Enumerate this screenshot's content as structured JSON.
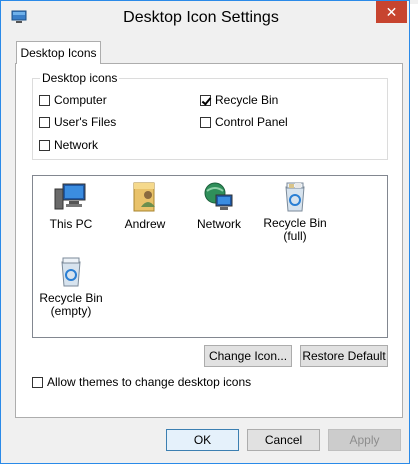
{
  "window": {
    "title": "Desktop Icon Settings",
    "close_symbol": "✕"
  },
  "tabs": [
    {
      "label": "Desktop Icons"
    }
  ],
  "desktop_icons_group": {
    "legend": "Desktop icons",
    "checkboxes": [
      {
        "label": "Computer",
        "checked": false
      },
      {
        "label": "User's Files",
        "checked": false
      },
      {
        "label": "Network",
        "checked": false
      },
      {
        "label": "Recycle Bin",
        "checked": true
      },
      {
        "label": "Control Panel",
        "checked": false
      }
    ]
  },
  "icon_list": {
    "items": [
      {
        "label": "This PC",
        "icon": "computer-icon"
      },
      {
        "label": "Andrew",
        "icon": "user-folder-icon"
      },
      {
        "label": "Network",
        "icon": "network-icon"
      },
      {
        "label": "Recycle Bin\n(full)",
        "icon": "recycle-bin-full-icon"
      },
      {
        "label": "Recycle Bin\n(empty)",
        "icon": "recycle-bin-empty-icon"
      }
    ]
  },
  "buttons": {
    "change_icon": "Change Icon...",
    "restore_default": "Restore Default",
    "ok": "OK",
    "cancel": "Cancel",
    "apply": "Apply"
  },
  "allow_themes": {
    "label": "Allow themes to change desktop icons",
    "checked": false
  },
  "colors": {
    "accent": "#2a8ae8",
    "close_button": "#c7442f"
  }
}
